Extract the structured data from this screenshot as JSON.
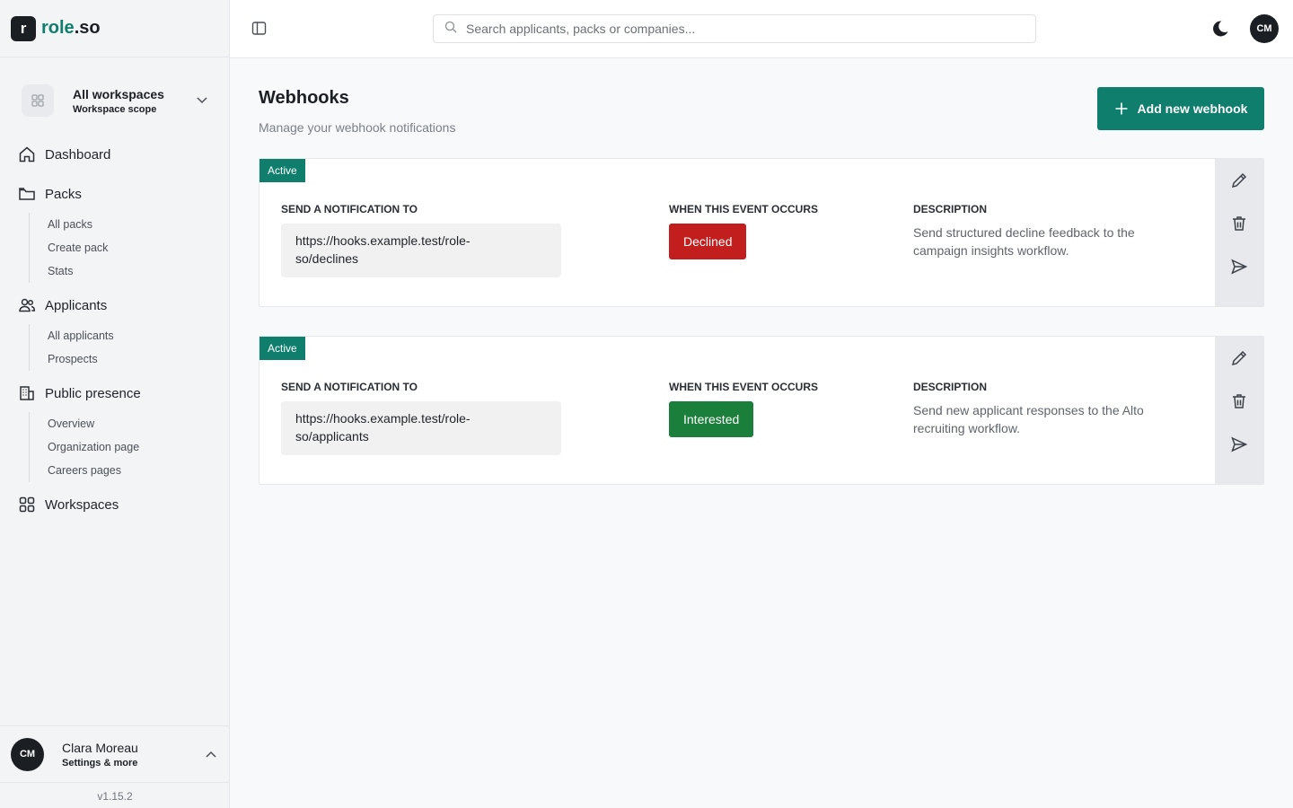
{
  "brand": {
    "mark": "r",
    "name_a": "role",
    "name_b": ".so"
  },
  "workspace": {
    "title": "All workspaces",
    "subtitle": "Workspace scope"
  },
  "nav": {
    "dashboard": "Dashboard",
    "packs": "Packs",
    "packs_sub": [
      "All packs",
      "Create pack",
      "Stats"
    ],
    "applicants": "Applicants",
    "applicants_sub": [
      "All applicants",
      "Prospects"
    ],
    "public_presence": "Public presence",
    "public_sub": [
      "Overview",
      "Organization page",
      "Careers pages"
    ],
    "workspaces": "Workspaces"
  },
  "user": {
    "initials": "CM",
    "name": "Clara Moreau",
    "subtitle": "Settings & more"
  },
  "version": "v1.15.2",
  "search": {
    "placeholder": "Search applicants, packs or companies..."
  },
  "header": {
    "avatar_initials": "CM"
  },
  "page": {
    "title": "Webhooks",
    "subtitle": "Manage your webhook notifications",
    "add_button": "Add new webhook"
  },
  "labels": {
    "send_to": "SEND A NOTIFICATION TO",
    "event": "WHEN THIS EVENT OCCURS",
    "description": "DESCRIPTION"
  },
  "webhooks": [
    {
      "status": "Active",
      "url_line1": "https://hooks.example.test/role-",
      "url_line2": "so/declines",
      "event": "Declined",
      "event_color": "#c21e1e",
      "description": "Send structured decline feedback to the campaign insights workflow."
    },
    {
      "status": "Active",
      "url_line1": "https://hooks.example.test/role-",
      "url_line2": "so/applicants",
      "event": "Interested",
      "event_color": "#1a7f3a",
      "description": "Send new applicant responses to the Alto recruiting workflow."
    }
  ],
  "colors": {
    "accent": "#0f7e6c",
    "sidebar_bg": "#f3f4f6",
    "dark": "#1b1f24"
  }
}
